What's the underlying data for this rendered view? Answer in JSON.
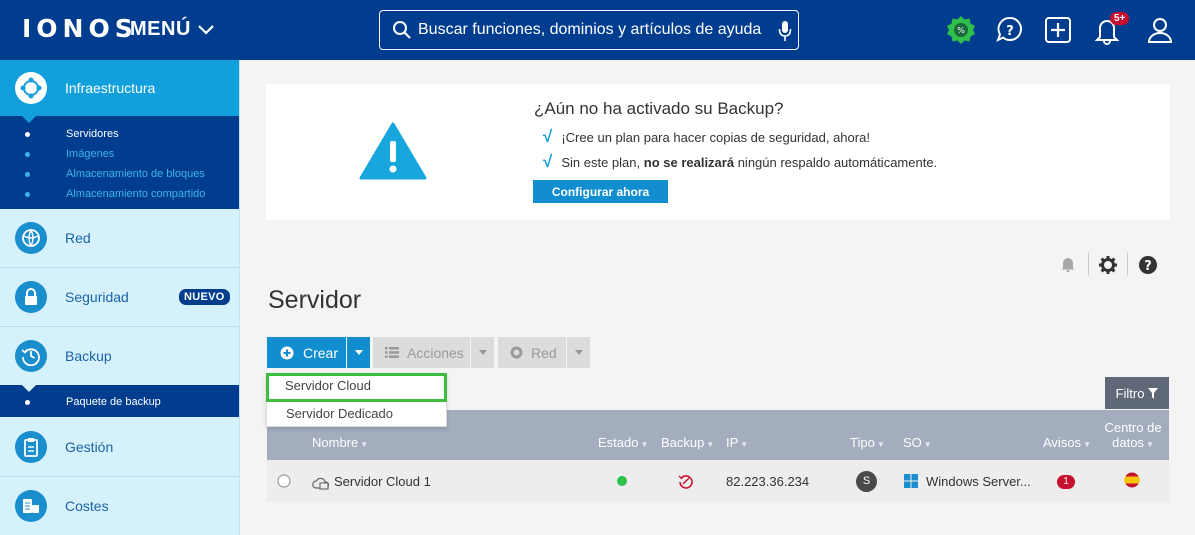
{
  "header": {
    "logo": "IONOS",
    "menu_label": "MENÚ",
    "search_placeholder": "Buscar funciones, dominios y artículos de ayuda",
    "notifications_badge": "5+"
  },
  "sidebar": {
    "items": [
      {
        "label": "Infraestructura"
      },
      {
        "label": "Red"
      },
      {
        "label": "Seguridad"
      },
      {
        "label": "Backup",
        "badge": "NUEVO"
      },
      {
        "label": "Gestión"
      },
      {
        "label": "Costes"
      }
    ],
    "infra_sub": [
      "Servidores",
      "Imágenes",
      "Almacenamiento de bloques",
      "Almacenamiento compartido"
    ],
    "backup_sub": [
      "Paquete de backup"
    ]
  },
  "banner": {
    "title": "¿Aún no ha activado su Backup?",
    "line1": "¡Cree un plan para hacer copias de seguridad, ahora!",
    "line2_pre": "Sin este plan,",
    "line2_bold": "no se realizará",
    "line2_post": "ningún respaldo automáticamente.",
    "button": "Configurar ahora"
  },
  "page": {
    "title": "Servidor",
    "crear": "Crear",
    "acciones": "Acciones",
    "red": "Red",
    "filtro": "Filtro"
  },
  "dropdown": [
    "Servidor Cloud",
    "Servidor Dedicado"
  ],
  "table": {
    "columns": {
      "nombre": "Nombre",
      "estado": "Estado",
      "backup": "Backup",
      "ip": "IP",
      "tipo": "Tipo",
      "so": "SO",
      "avisos": "Avisos",
      "centro1": "Centro de",
      "centro2": "datos"
    },
    "rows": [
      {
        "nombre": "Servidor Cloud 1",
        "ip": "82.223.36.234",
        "tipo": "S",
        "so": "Windows Server...",
        "avisos": "1"
      }
    ]
  },
  "colors": {
    "header_bg": "#003d8f",
    "accent": "#118ecf",
    "highlight": "#3dbd3d",
    "status_ok": "#2ec04b"
  }
}
